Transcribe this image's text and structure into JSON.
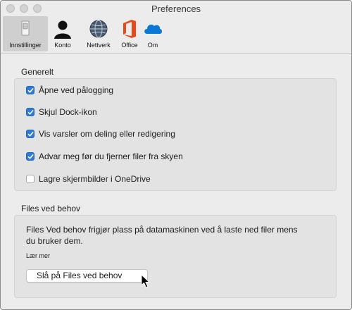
{
  "window": {
    "title": "Preferences"
  },
  "toolbar": {
    "items": [
      {
        "label": "Innstillinger",
        "icon": "settings-switch-icon",
        "selected": true
      },
      {
        "label": "Konto",
        "icon": "person-icon",
        "selected": false
      },
      {
        "label": "Nettverk",
        "icon": "globe-icon",
        "selected": false
      },
      {
        "label": "Office",
        "icon": "office-icon",
        "selected": false
      },
      {
        "label": "Om",
        "icon": "cloud-icon",
        "selected": false
      }
    ]
  },
  "general": {
    "title": "Generelt",
    "options": [
      {
        "label": "Åpne ved pålogging",
        "checked": true
      },
      {
        "label": "Skjul Dock-ikon",
        "checked": true
      },
      {
        "label": "Vis varsler om deling eller redigering",
        "checked": true
      },
      {
        "label": "Advar meg før du fjerner filer fra skyen",
        "checked": true
      },
      {
        "label": "Lagre skjermbilder i OneDrive",
        "checked": false
      }
    ]
  },
  "files_on_demand": {
    "title": "Files ved behov",
    "description": "Files Ved behov frigjør plass på datamaskinen ved å laste ned filer mens du bruker dem.",
    "learn_more": "Lær mer",
    "button_label": "Slå på Files ved behov"
  },
  "colors": {
    "accent": "#2e7bd6",
    "office": "#e64a19",
    "onedrive": "#0a78d4"
  }
}
